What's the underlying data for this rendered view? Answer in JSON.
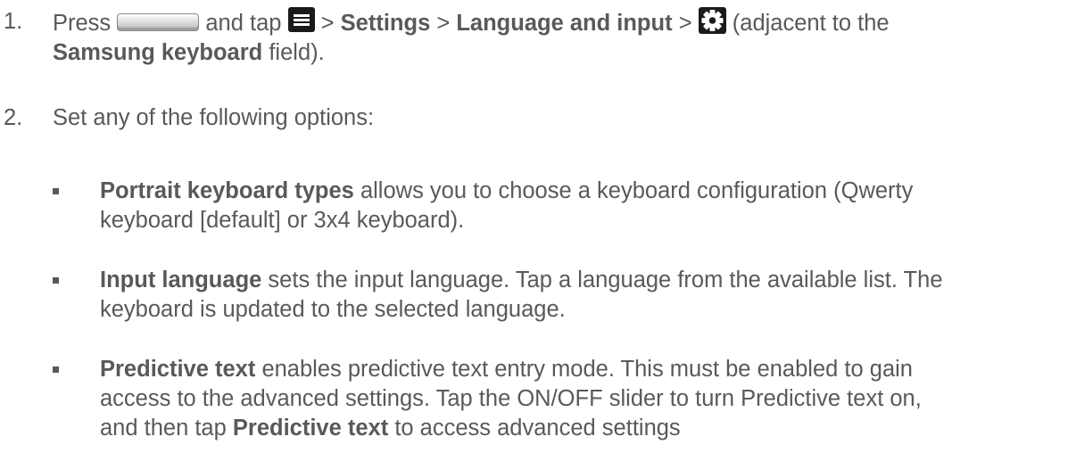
{
  "steps": [
    {
      "number": "1.",
      "line1": {
        "press": "Press",
        "and_tap": "and tap",
        "sep1": ">",
        "settings": "Settings",
        "sep2": ">",
        "language_and_input": "Language and input",
        "sep3": ">",
        "adjacent_to": "(adjacent to the"
      },
      "line2": {
        "samsung_keyboard": "Samsung keyboard",
        "field": "field)."
      },
      "icons": [
        "home-key-icon",
        "menu-key-icon",
        "settings-gear-icon"
      ]
    },
    {
      "number": "2.",
      "text": "Set any of the following options:"
    }
  ],
  "options": [
    {
      "term": "Portrait keyboard types",
      "rest": "allows you to choose a keyboard configuration (Qwerty",
      "line2": "keyboard [default] or 3x4 keyboard)."
    },
    {
      "term": "Input language",
      "rest": "sets the input language. Tap a language from the available list. The",
      "line2": "keyboard is updated to the selected language."
    },
    {
      "term": "Predictive text",
      "rest": "enables predictive text entry mode. This must be enabled to gain",
      "line2": "access to the advanced settings. Tap the ON/OFF slider to turn Predictive text on,",
      "line3_pre": "and then tap",
      "line3_term": "Predictive text",
      "line3_post": "to access advanced settings"
    }
  ]
}
